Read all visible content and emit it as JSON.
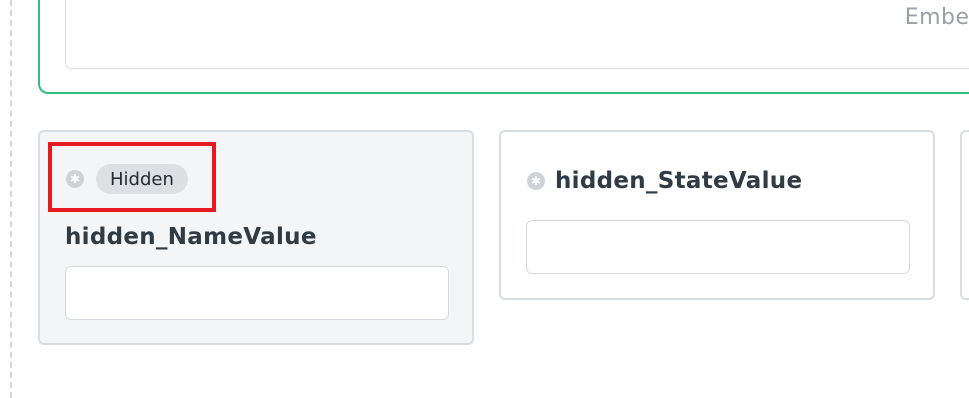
{
  "top_block": {
    "embed_text": "Embed"
  },
  "fields": [
    {
      "badge": "Hidden",
      "label": "hidden_NameValue",
      "value": ""
    },
    {
      "label": "hidden_StateValue",
      "value": ""
    }
  ],
  "icons": {
    "drag": "asterisk-icon"
  },
  "colors": {
    "top_border": "#2cc27a",
    "highlight": "#e41b23",
    "badge_bg": "#dde0e3",
    "card_border": "#d8dde2"
  }
}
